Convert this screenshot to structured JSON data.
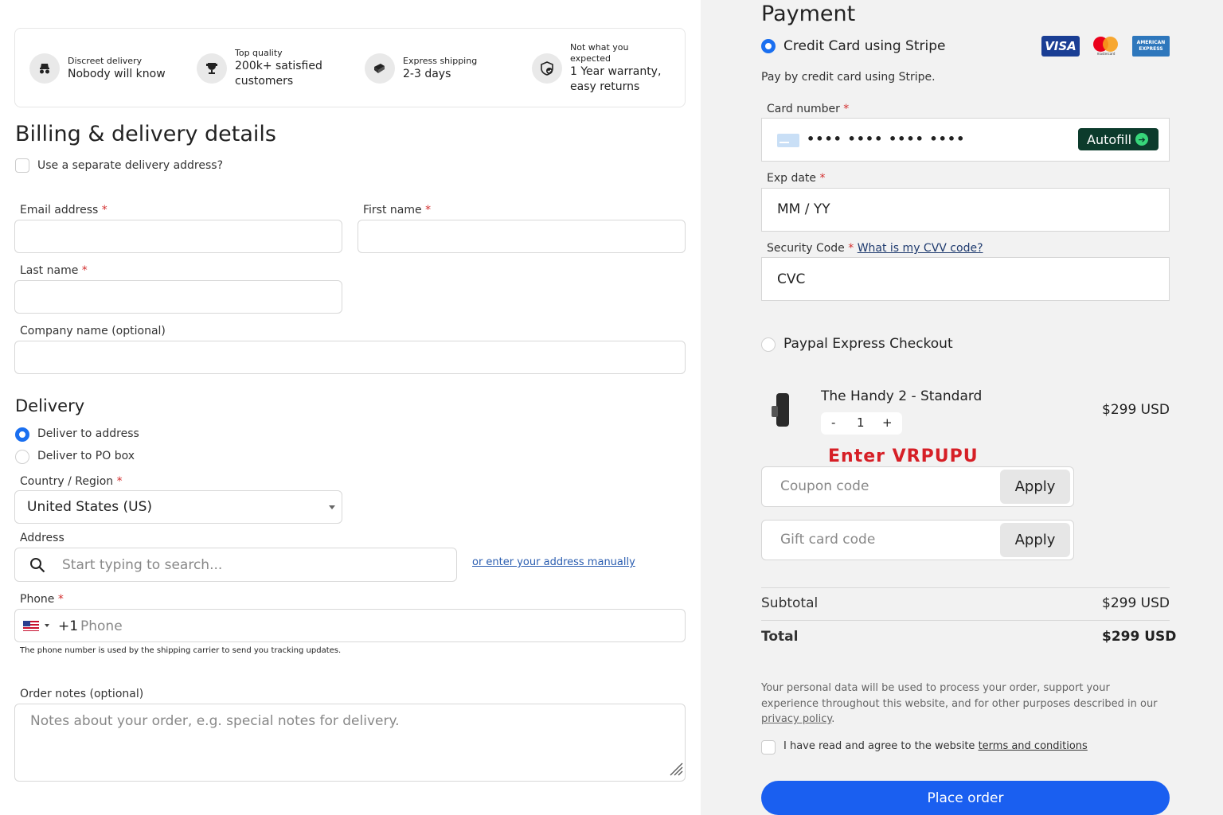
{
  "features": [
    {
      "icon": "incognito-icon",
      "small": "Discreet delivery",
      "big": "Nobody will know"
    },
    {
      "icon": "trophy-icon",
      "small": "Top quality",
      "big": "200k+ satisfied customers"
    },
    {
      "icon": "truck-icon",
      "small": "Express shipping",
      "big": "2-3 days"
    },
    {
      "icon": "shield-check-icon",
      "small": "Not what you expected",
      "big": "1 Year warranty, easy returns"
    }
  ],
  "billing": {
    "title": "Billing & delivery details",
    "separate_address": "Use a separate delivery address?",
    "email_label": "Email address",
    "first_name_label": "First name",
    "last_name_label": "Last name",
    "company_label": "Company name (optional)",
    "required_mark": "*"
  },
  "delivery": {
    "title": "Delivery",
    "option_address": "Deliver to address",
    "option_po": "Deliver to PO box",
    "country_label": "Country / Region",
    "country_value": "United States (US)",
    "address_label": "Address",
    "address_placeholder": "Start typing to search...",
    "manual_link": "or enter your address manually",
    "phone_label": "Phone",
    "phone_code": "+1",
    "phone_placeholder": "Phone",
    "phone_help": "The phone number is used by the shipping carrier to send you tracking updates.",
    "notes_label": "Order notes (optional)",
    "notes_placeholder": "Notes about your order, e.g. special notes for delivery."
  },
  "payment": {
    "title": "Payment",
    "method_stripe": "Credit Card using Stripe",
    "stripe_desc": "Pay by credit card using Stripe.",
    "card_brands": [
      "VISA",
      "mastercard",
      "AMERICAN EXPRESS"
    ],
    "card_number_label": "Card number",
    "card_number_value": "•••• •••• •••• ••••",
    "autofill": "Autofill",
    "exp_label": "Exp date",
    "exp_placeholder": "MM / YY",
    "cvv_label": "Security Code",
    "cvv_link": "What is my CVV code?",
    "cvv_placeholder": "CVC",
    "method_paypal": "Paypal Express Checkout"
  },
  "cart": {
    "product_name": "The Handy 2 - Standard",
    "qty_minus": "-",
    "qty": "1",
    "qty_plus": "+",
    "price": "$299 USD",
    "promo_note": "Enter VRPUPU",
    "coupon_placeholder": "Coupon code",
    "gift_placeholder": "Gift card code",
    "apply": "Apply",
    "subtotal_label": "Subtotal",
    "subtotal_value": "$299 USD",
    "total_label": "Total",
    "total_value": "$299 USD"
  },
  "legal": {
    "privacy_text": "Your personal data will be used to process your order, support your experience throughout this website, and for other purposes described in our",
    "privacy_link": "privacy policy",
    "privacy_end": ".",
    "terms_text": "I have read and agree to the website",
    "terms_link": "terms and conditions"
  },
  "place_order": "Place order",
  "colors": {
    "accent": "#1a5ff0",
    "promo": "#d61f26",
    "autofill_bg": "#0c3b2c"
  }
}
